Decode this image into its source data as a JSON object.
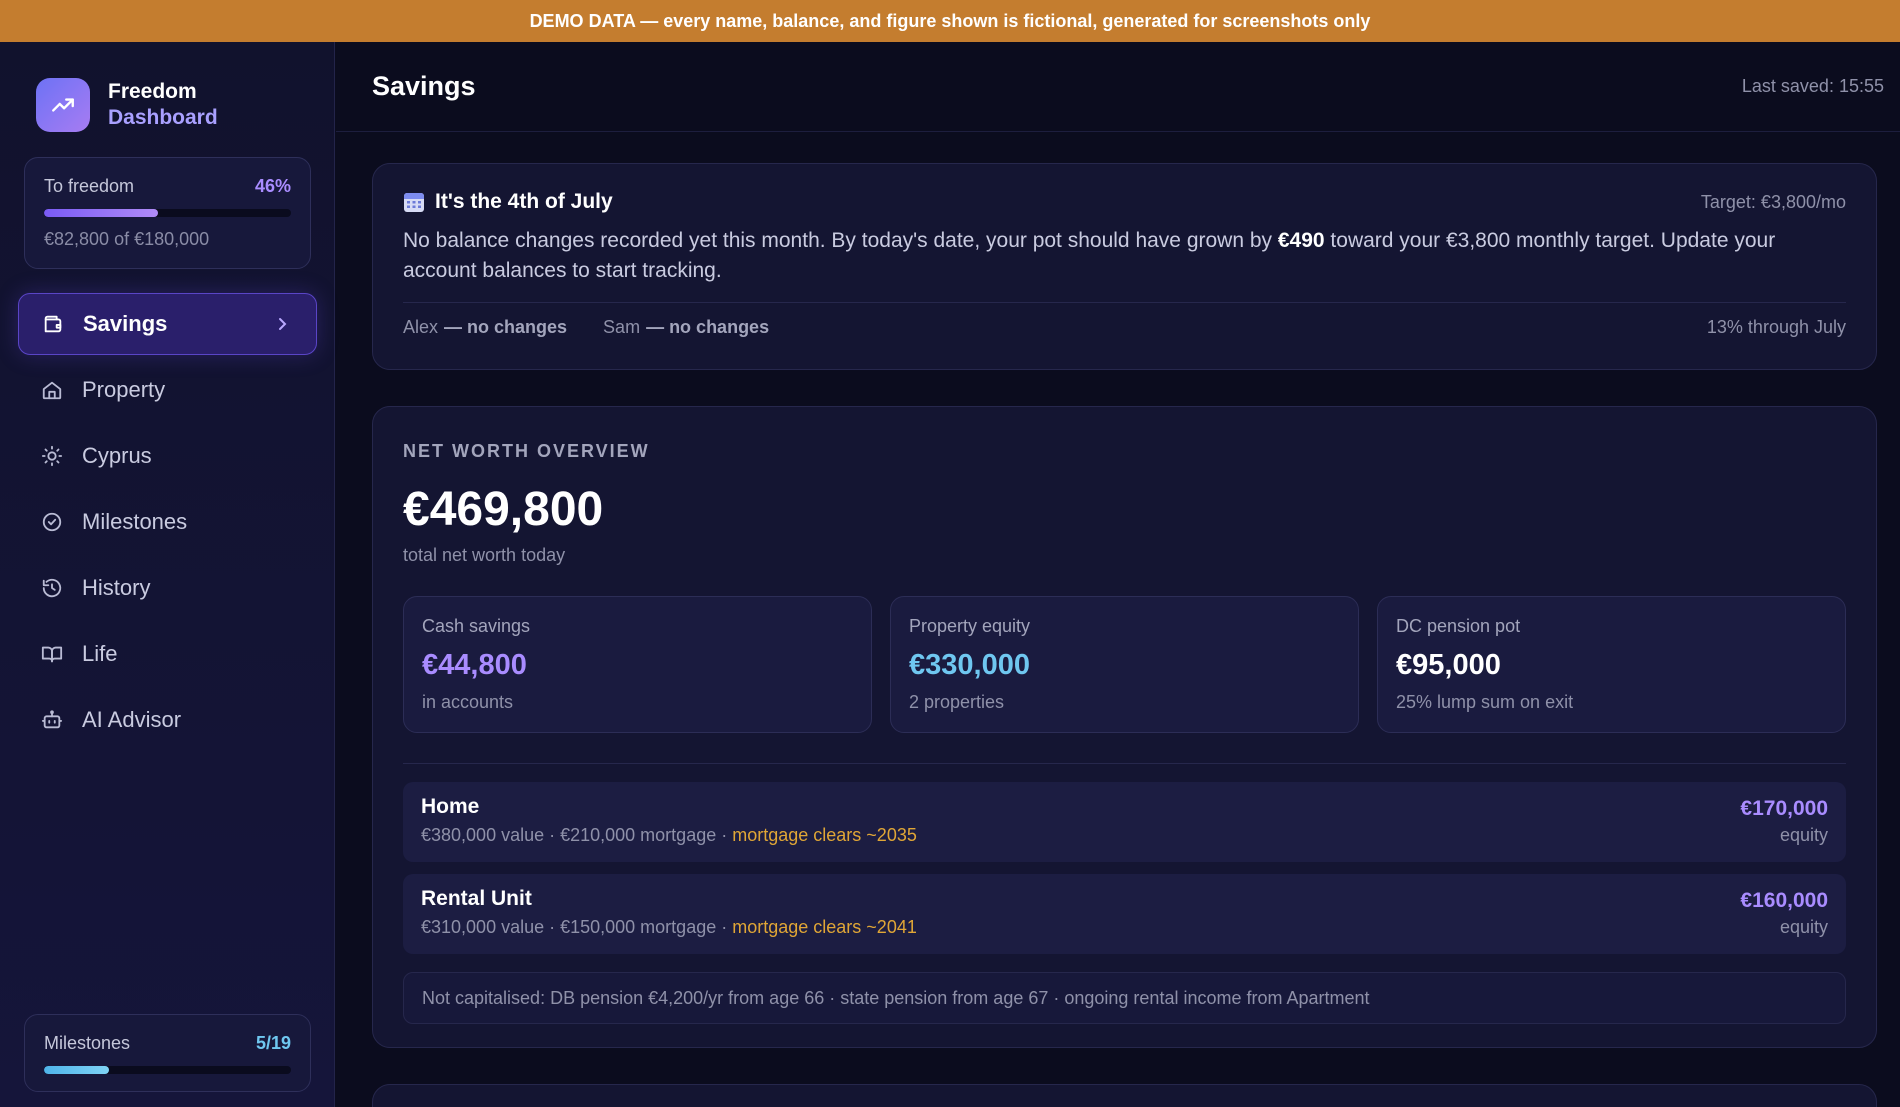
{
  "banner": {
    "text": "DEMO DATA — every name, balance, and figure shown is fictional, generated for screenshots only"
  },
  "brand": {
    "line1": "Freedom",
    "line2": "Dashboard"
  },
  "freedom_progress": {
    "label": "To freedom",
    "percent_label": "46%",
    "percent": 46,
    "subtitle": "€82,800 of €180,000"
  },
  "nav": {
    "items": [
      {
        "label": "Savings",
        "icon": "wallet-icon",
        "active": true
      },
      {
        "label": "Property",
        "icon": "home-icon"
      },
      {
        "label": "Cyprus",
        "icon": "sun-icon"
      },
      {
        "label": "Milestones",
        "icon": "check-circle-icon"
      },
      {
        "label": "History",
        "icon": "history-icon"
      },
      {
        "label": "Life",
        "icon": "book-icon"
      },
      {
        "label": "AI Advisor",
        "icon": "robot-icon"
      }
    ]
  },
  "milestones_progress": {
    "label": "Milestones",
    "count_label": "5/19",
    "done": 5,
    "total": 19
  },
  "header": {
    "title": "Savings",
    "last_saved": "Last saved: 15:55"
  },
  "july_card": {
    "title": "It's the 4th of July",
    "target": "Target: €3,800/mo",
    "msg_part1": "No balance changes recorded yet this month. By today's date, your pot should have grown by ",
    "msg_bold": "€490",
    "msg_part2": " toward your €3,800 monthly target. Update your account balances to start tracking.",
    "people": [
      {
        "name": "Alex",
        "status": "— no changes"
      },
      {
        "name": "Sam",
        "status": "— no changes"
      }
    ],
    "month_progress": "13% through July"
  },
  "net_worth": {
    "section_title": "NET WORTH OVERVIEW",
    "total": "€469,800",
    "total_sub": "total net worth today",
    "stats": [
      {
        "label": "Cash savings",
        "value": "€44,800",
        "sub": "in accounts",
        "color": "#a98cff"
      },
      {
        "label": "Property equity",
        "value": "€330,000",
        "sub": "2 properties",
        "color": "#6fc7f0"
      },
      {
        "label": "DC pension pot",
        "value": "€95,000",
        "sub": "25% lump sum on exit",
        "color": "#ffffff"
      }
    ],
    "properties": [
      {
        "name": "Home",
        "detail": "€380,000 value · €210,000 mortgage · ",
        "clears": "mortgage clears ~2035",
        "equity": "€170,000",
        "equity_label": "equity"
      },
      {
        "name": "Rental Unit",
        "detail": "€310,000 value · €150,000 mortgage · ",
        "clears": "mortgage clears ~2041",
        "equity": "€160,000",
        "equity_label": "equity"
      }
    ],
    "note": "Not capitalised: DB pension €4,200/yr from age 66 · state pension from age 67 · ongoing rental income from Apartment"
  }
}
